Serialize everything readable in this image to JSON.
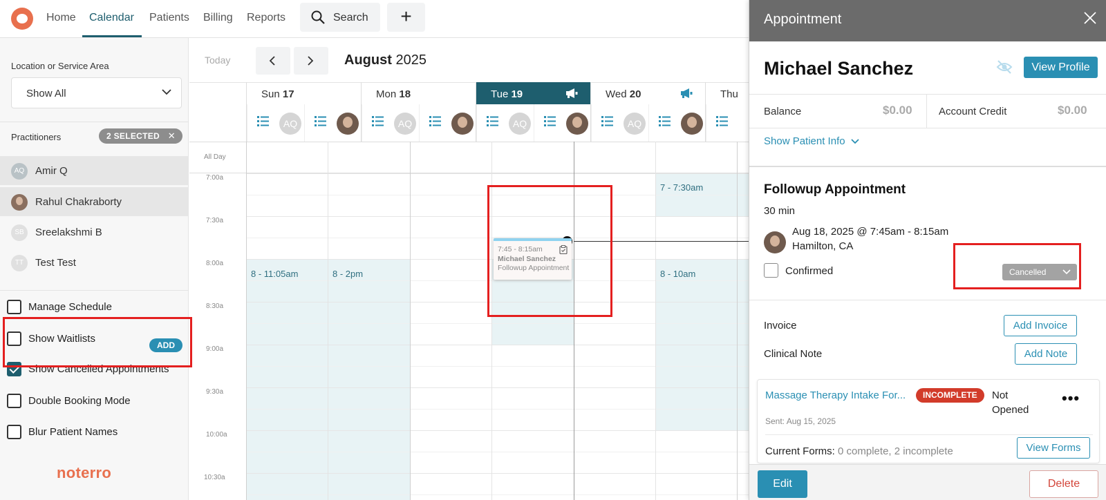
{
  "nav": {
    "items": [
      "Home",
      "Calendar",
      "Patients",
      "Billing",
      "Reports"
    ],
    "search_label": "Search",
    "add_label": "+"
  },
  "sidebar": {
    "location_label": "Location or Service Area",
    "location_value": "Show All",
    "practitioners_label": "Practitioners",
    "selected_badge": "2 SELECTED",
    "practitioners": [
      {
        "initials": "AQ",
        "name": "Amir Q",
        "selected": true
      },
      {
        "initials": "",
        "name": "Rahul Chakraborty",
        "selected": true
      },
      {
        "initials": "SB",
        "name": "Sreelakshmi B",
        "selected": false
      },
      {
        "initials": "TT",
        "name": "Test Test",
        "selected": false
      }
    ],
    "options": [
      {
        "label": "Manage Schedule",
        "checked": false
      },
      {
        "label": "Show Waitlists",
        "checked": false
      },
      {
        "label": "Show Cancelled Appointments",
        "checked": true
      },
      {
        "label": "Double Booking Mode",
        "checked": false
      },
      {
        "label": "Blur Patient Names",
        "checked": false
      }
    ],
    "waitlist_add": "ADD",
    "brand": "noterro"
  },
  "calendar": {
    "today_label": "Today",
    "month": "August",
    "year": "2025",
    "days": [
      {
        "name": "Sun",
        "num": "17",
        "today": false,
        "announce": false
      },
      {
        "name": "Mon",
        "num": "18",
        "today": false,
        "announce": false
      },
      {
        "name": "Tue",
        "num": "19",
        "today": true,
        "announce": true
      },
      {
        "name": "Wed",
        "num": "20",
        "today": false,
        "announce": true
      },
      {
        "name": "Thu",
        "num": "",
        "today": false,
        "announce": false
      }
    ],
    "practitioner_initials": "AQ",
    "allday_label": "All Day",
    "time_labels": [
      "7:00a",
      "7:30a",
      "8:00a",
      "8:30a",
      "9:00a",
      "9:30a",
      "10:00a",
      "10:30a"
    ],
    "availability": [
      {
        "label": "8 - 11:05am"
      },
      {
        "label": "8 - 2pm"
      },
      {
        "label": ""
      },
      {
        "label": "7 - 7:30am"
      },
      {
        "label": "8 - 10am"
      }
    ],
    "appointment": {
      "time": "7:45 - 8:15am",
      "patient": "Michael Sanchez",
      "type": "Followup Appointment"
    }
  },
  "panel": {
    "title": "Appointment",
    "patient_name": "Michael Sanchez",
    "view_profile": "View Profile",
    "balance_label": "Balance",
    "balance_value": "$0.00",
    "credit_label": "Account Credit",
    "credit_value": "$0.00",
    "show_info": "Show Patient Info",
    "appt_title": "Followup Appointment",
    "duration": "30 min",
    "datetime": "Aug 18, 2025 @ 7:45am - 8:15am",
    "location": "Hamilton, CA",
    "confirmed_label": "Confirmed",
    "status": "Cancelled",
    "invoice_label": "Invoice",
    "add_invoice": "Add Invoice",
    "note_label": "Clinical Note",
    "add_note": "Add Note",
    "form": {
      "name": "Massage Therapy Intake For...",
      "badge": "INCOMPLETE",
      "status": "Not Opened",
      "more": "•••",
      "sent": "Sent: Aug 15, 2025",
      "current_label": "Current Forms:",
      "current_value": "0 complete, 2 incomplete",
      "view_forms": "View Forms"
    },
    "edit": "Edit",
    "delete": "Delete"
  },
  "colors": {
    "accent": "#1e5e6e",
    "link": "#2a8fb3",
    "brand": "#e8704e",
    "danger": "#d23b2a",
    "highlight_box": "#e41f1f",
    "availability": "#e8f3f5"
  }
}
